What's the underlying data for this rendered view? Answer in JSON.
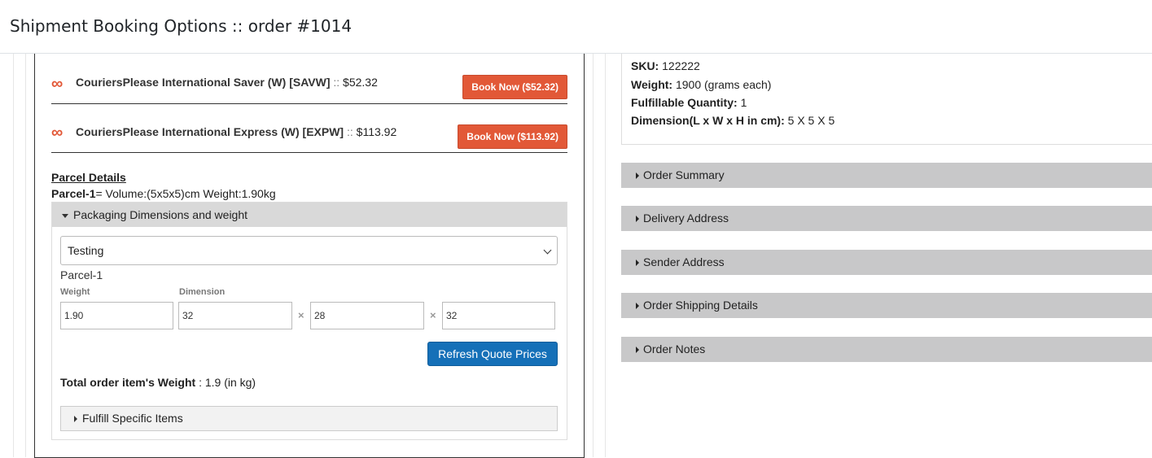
{
  "header": {
    "title": "Shipment Booking Options :: order #1014"
  },
  "rates": [
    {
      "service": "CouriersPlease International Saver (W) [SAVW]",
      "separator": "::",
      "price": "$52.32",
      "button_label": "Book Now ($52.32)"
    },
    {
      "service": "CouriersPlease International Express (W) [EXPW]",
      "separator": "::",
      "price": "$113.92",
      "button_label": "Book Now ($113.92)"
    }
  ],
  "parcel": {
    "title": "Parcel Details",
    "name_label": "Parcel-1",
    "summary": "= Volume:(5x5x5)cm Weight:1.90kg"
  },
  "packaging": {
    "header": "Packaging Dimensions and weight",
    "selected_option": "Testing",
    "parcel_name": "Parcel-1",
    "weight_label": "Weight",
    "dimension_label": "Dimension",
    "weight_value": "1.90",
    "dim_l": "32",
    "dim_w": "28",
    "dim_h": "32",
    "times_symbol": "×",
    "refresh_label": "Refresh Quote Prices",
    "total_label": "Total order item's Weight",
    "total_value": ": 1.9 (in kg)",
    "fulfill_label": "Fulfill Specific Items"
  },
  "item_details": {
    "sku_label": "SKU:",
    "sku_value": "122222",
    "weight_label": "Weight:",
    "weight_value": "1900 (grams each)",
    "qty_label": "Fulfillable Quantity:",
    "qty_value": "1",
    "dim_label": "Dimension(L x W x H in cm):",
    "dim_value": "5 X 5 X 5"
  },
  "accordions": [
    {
      "label": "Order Summary"
    },
    {
      "label": "Delivery Address"
    },
    {
      "label": "Sender Address"
    },
    {
      "label": "Order Shipping Details"
    },
    {
      "label": "Order Notes"
    }
  ],
  "colors": {
    "book_button": "#e25837",
    "refresh_button": "#1570b8",
    "accordion_bar": "#c8c8c9"
  },
  "icons": {
    "rate_icon": "infinity-icon",
    "expand_icon": "caret-down-icon",
    "collapsed_icon": "caret-right-icon"
  }
}
